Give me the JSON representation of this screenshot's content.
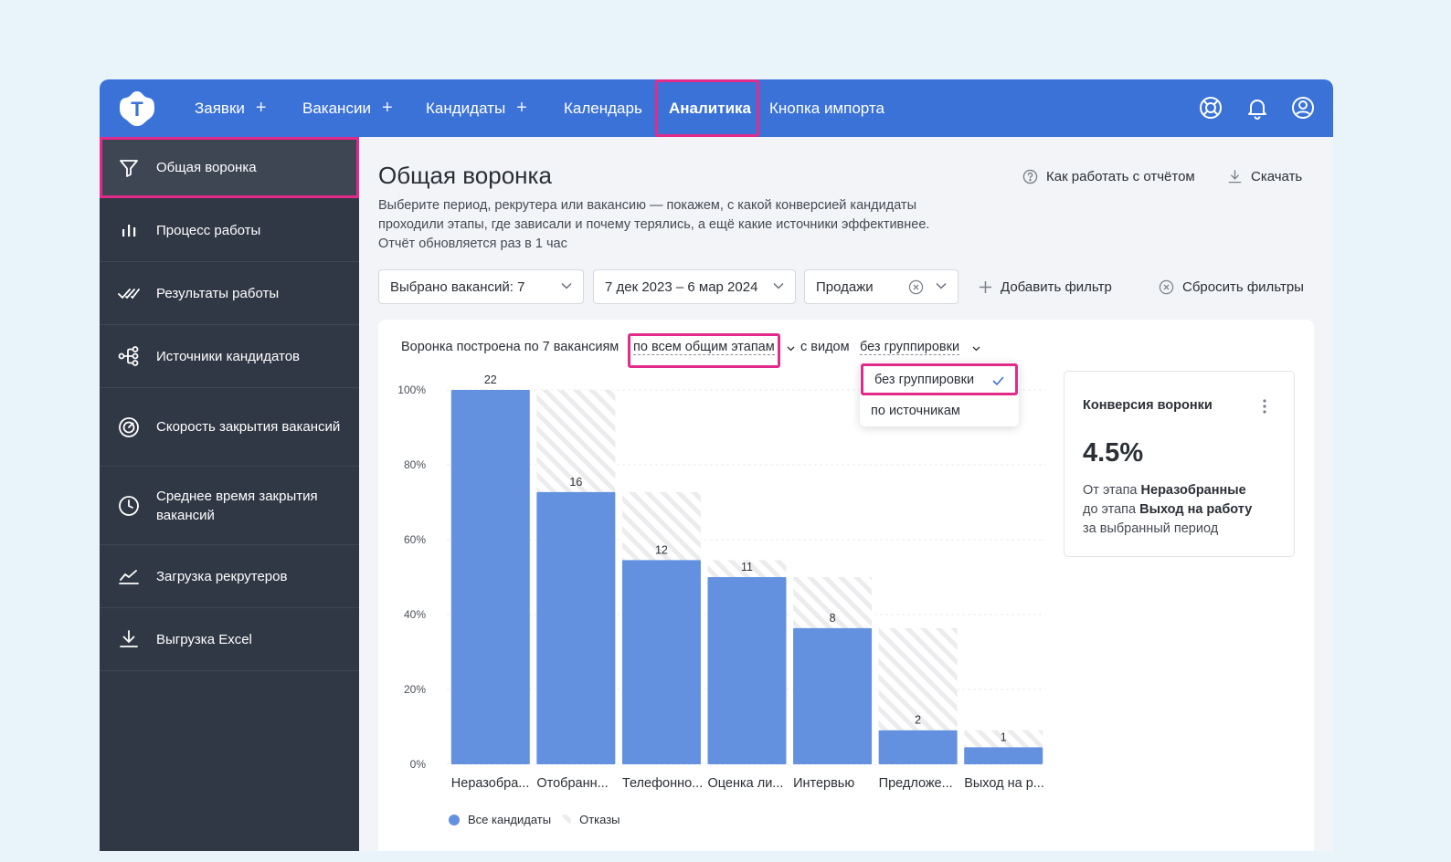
{
  "topbar": {
    "logo_letter": "T",
    "nav": [
      {
        "label": "Заявки",
        "plus": "+"
      },
      {
        "label": "Вакансии",
        "plus": "+"
      },
      {
        "label": "Кандидаты",
        "plus": "+"
      },
      {
        "label": "Календарь"
      },
      {
        "label": "Аналитика",
        "active": true
      },
      {
        "label": "Кнопка импорта"
      }
    ],
    "icons": [
      "help-lifebuoy-icon",
      "bell-icon",
      "user-avatar-icon"
    ],
    "accent": "#3a72d8",
    "highlight": "#e22a8b"
  },
  "sidebar": {
    "items": [
      {
        "label": "Общая воронка",
        "icon": "funnel-icon",
        "active": true
      },
      {
        "label": "Процесс работы",
        "icon": "bars-icon"
      },
      {
        "label": "Результаты работы",
        "icon": "double-check-icon"
      },
      {
        "label": "Источники кандидатов",
        "icon": "share-nodes-icon"
      },
      {
        "label": "Скорость закрытия вакансий",
        "icon": "speedometer-icon"
      },
      {
        "label": "Среднее время закрытия вакансий",
        "icon": "clock-icon"
      },
      {
        "label": "Загрузка рекрутеров",
        "icon": "trend-line-icon"
      },
      {
        "label": "Выгрузка Excel",
        "icon": "download-icon"
      }
    ]
  },
  "main": {
    "title": "Общая воронка",
    "description": [
      "Выберите период, рекрутера или вакансию — покажем, с какой конверсией кандидаты",
      "проходили этапы, где зависали и почему терялись, а ещё какие источники эффективнее.",
      "Отчёт обновляется раз в 1 час"
    ],
    "help_link": "Как работать с отчётом",
    "download_link": "Скачать",
    "filters": {
      "vacancies": "Выбрано вакансий: 7",
      "period": "7 дек 2023 – 6 мар 2024",
      "department": "Продажи",
      "add_filter": "Добавить фильтр",
      "reset_filters": "Сбросить фильтры"
    }
  },
  "report": {
    "caption_prefix": "Воронка построена по 7 вакансиям",
    "stage_mode": "по всем общим этапам",
    "view_label": "с видом",
    "grouping": "без группировки",
    "grouping_options": [
      "без группировки",
      "по источникам"
    ],
    "conversion": {
      "title": "Конверсия воронки",
      "value": "4.5%",
      "from_text": "От этапа",
      "from_stage": "Неразобранные",
      "to_text": "до этапа",
      "to_stage": "Выход на работу",
      "period_text": "за выбранный период"
    }
  },
  "chart_data": {
    "type": "bar",
    "categories": [
      "Неразобра...",
      "Отобранн...",
      "Телефонно...",
      "Оценка ли...",
      "Интервью",
      "Предложе...",
      "Выход на р..."
    ],
    "series": [
      {
        "name": "Все кандидаты",
        "values": [
          22,
          16,
          12,
          11,
          8,
          2,
          1
        ],
        "color": "#6391e0"
      },
      {
        "name": "Отказы",
        "values": [
          0,
          6,
          4,
          1,
          3,
          6,
          1
        ],
        "pattern": "hatched"
      }
    ],
    "y_ticks": [
      "100%",
      "80%",
      "60%",
      "40%",
      "20%",
      "0%"
    ],
    "ylim": [
      0,
      22
    ],
    "grid": true,
    "legend_position": "bottom-left"
  }
}
